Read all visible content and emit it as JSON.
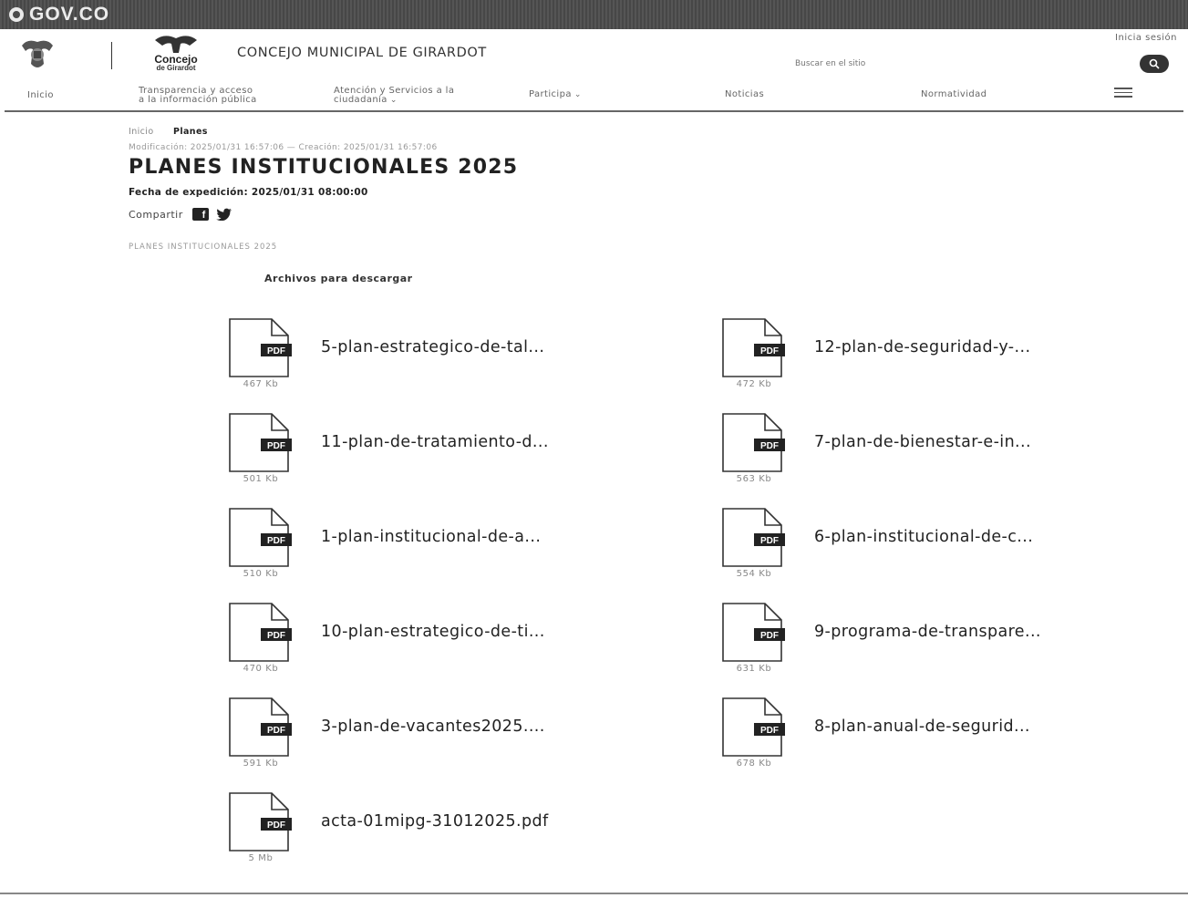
{
  "govbar": {
    "brand": "GOV.CO"
  },
  "header": {
    "site_title": "CONCEJO MUNICIPAL DE GIRARDOT",
    "logo_name": "Concejo",
    "logo_sub": "de Girardot",
    "login": "Inicia sesión",
    "search_placeholder": "Buscar en el sitio"
  },
  "nav": {
    "inicio": "Inicio",
    "transparencia_1": "Transparencia y acceso",
    "transparencia_2": "a la información pública",
    "atencion_1": "Atención y Servicios a la",
    "atencion_2": "ciudadanía",
    "participa": "Participa",
    "noticias": "Noticias",
    "normatividad": "Normatividad"
  },
  "breadcrumb": {
    "home": "Inicio",
    "current": "Planes"
  },
  "meta": {
    "dates": "Modificación: 2025/01/31 16:57:06 — Creación: 2025/01/31 16:57:06",
    "title": "PLANES INSTITUCIONALES 2025",
    "issue_date": "Fecha de expedición: 2025/01/31 08:00:00",
    "share_label": "Compartir",
    "caption": "PLANES INSTITUCIONALES 2025"
  },
  "downloads": {
    "heading": "Archivos para descargar",
    "icon_label": "PDF",
    "files": [
      {
        "name": "5-plan-estrategico-de-tal...",
        "size": "467 Kb"
      },
      {
        "name": "12-plan-de-seguridad-y-...",
        "size": "472 Kb"
      },
      {
        "name": "11-plan-de-tratamiento-d...",
        "size": "501 Kb"
      },
      {
        "name": "7-plan-de-bienestar-e-in...",
        "size": "563 Kb"
      },
      {
        "name": "1-plan-institucional-de-a...",
        "size": "510 Kb"
      },
      {
        "name": "6-plan-institucional-de-c...",
        "size": "554 Kb"
      },
      {
        "name": "10-plan-estrategico-de-ti...",
        "size": "470 Kb"
      },
      {
        "name": "9-programa-de-transpare...",
        "size": "631 Kb"
      },
      {
        "name": "3-plan-de-vacantes2025....",
        "size": "591 Kb"
      },
      {
        "name": "8-plan-anual-de-segurid...",
        "size": "678 Kb"
      },
      {
        "name": "acta-01mipg-31012025.pdf",
        "size": "5 Mb"
      }
    ]
  }
}
